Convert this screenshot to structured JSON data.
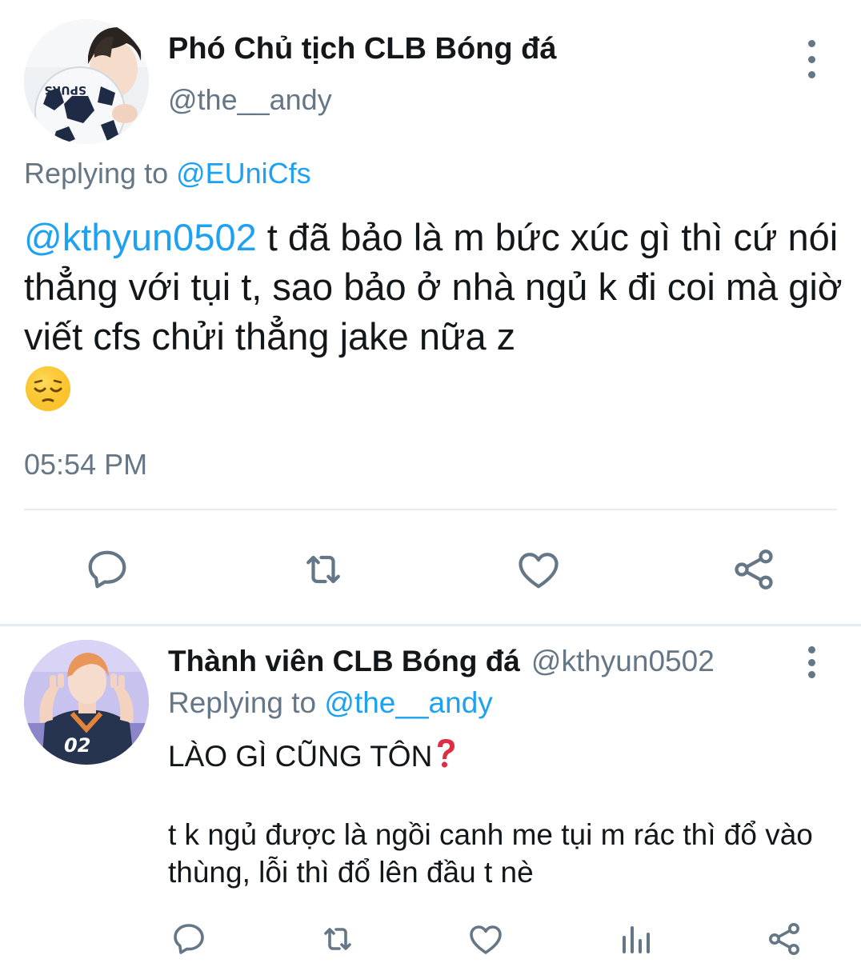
{
  "main_tweet": {
    "display_name": "Phó Chủ tịch CLB Bóng đá",
    "handle": "@the__andy",
    "replying_prefix": "Replying to ",
    "replying_handle": "@EUniCfs",
    "mention": "@kthyun0502",
    "text": " t đã bảo là m bức xúc gì thì cứ nói thẳng với tụi t, sao bảo ở nhà ngủ k đi coi mà giờ viết cfs chửi thẳng jake nữa z",
    "emoji": "pensive-face",
    "timestamp": "05:54 PM",
    "avatar_ball_text": "SPURS",
    "actions": [
      "reply-icon",
      "retweet-icon",
      "like-icon",
      "share-icon"
    ]
  },
  "reply_tweet": {
    "display_name": "Thành viên CLB Bóng đá",
    "handle": "@kthyun0502",
    "replying_prefix": "Replying to ",
    "replying_handle": "@the__andy",
    "text_line1": "LÀO GÌ CŨNG TÔN",
    "emoji": "red-question-mark",
    "text_para2": "t k ngủ được là ngồi canh me tụi m rác thì đổ vào thùng, lỗi thì đổ lên đầu t nè",
    "avatar_shirt_number": "02",
    "actions": [
      "reply-icon",
      "retweet-icon",
      "like-icon",
      "analytics-icon",
      "share-icon"
    ]
  },
  "colors": {
    "link": "#1da1f2",
    "secondary_text": "#657786",
    "primary_text": "#14171a",
    "divider": "#e6ecf0"
  }
}
